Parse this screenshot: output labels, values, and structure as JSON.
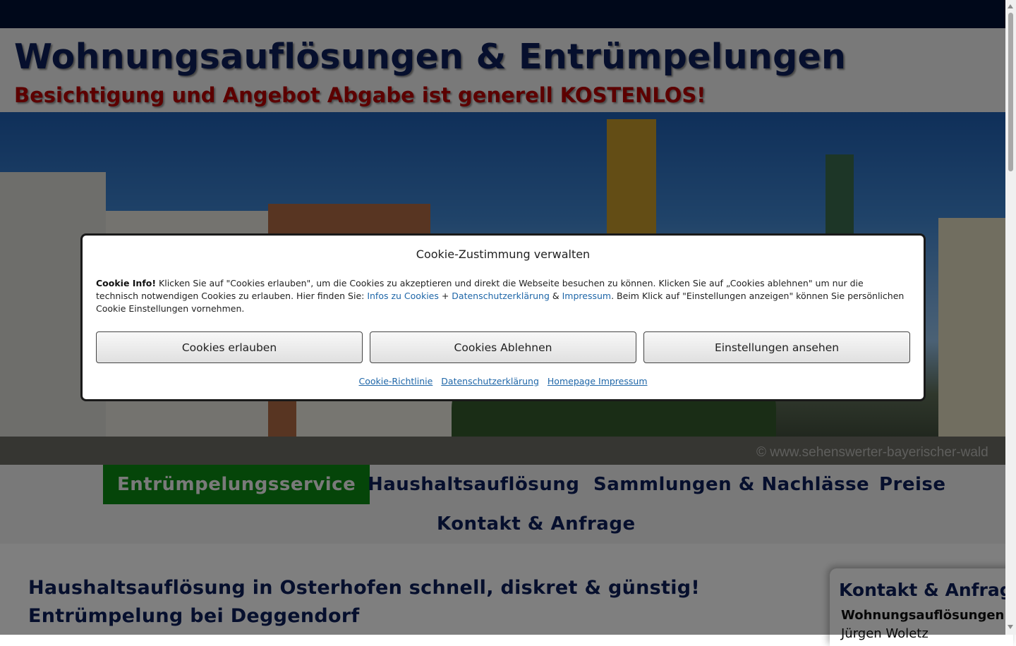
{
  "header": {
    "title": "Wohnungsauflösungen & Entrümpelungen",
    "subtitle": "Besichtigung und Angebot Abgabe ist generell KOSTENLOS!"
  },
  "hero": {
    "watermark": "© www.sehenswerter-bayerischer-wald"
  },
  "nav": {
    "items": [
      {
        "label": "Entrümpelungsservice",
        "active": true
      },
      {
        "label": "Haushaltsauflösung"
      },
      {
        "label": "Sammlungen & Nachlässe"
      },
      {
        "label": "Preise"
      },
      {
        "label": "Kontakt & Anfrage"
      }
    ]
  },
  "main": {
    "title": "Haushaltsauflösung in Osterhofen schnell, diskret & günstig! Entrümpe­lung bei Deggendorf"
  },
  "sidebar_widget": {
    "title": "Kontakt & Anfrag",
    "line1": "Wohnungsauflösungen",
    "line2": "Jürgen Woletz"
  },
  "cookie_dialog": {
    "title": "Cookie-Zustimmung verwalten",
    "info_label": "Cookie Info!",
    "text_part1": " Klicken Sie auf \"Cookies erlauben\", um die Cookies zu akzeptieren und direkt die Webseite besuchen zu können. Klicken Sie auf „Cookies ablehnen\" um nur die technisch notwendigen Cookies zu erlauben. Hier finden Sie: ",
    "link_infos": "Infos zu Cookies",
    "plus": " + ",
    "link_privacy": "Datenschutzerklärung",
    "amp": " & ",
    "link_imprint": "Impressum",
    "text_part2": ". Beim Klick auf \"Einstellungen anzeigen\" können Sie persönlichen Cookie Einstellungen vornehmen.",
    "buttons": {
      "accept": "Cookies erlauben",
      "deny": "Cookies Ablehnen",
      "settings": "Einstellungen ansehen"
    },
    "footer_links": {
      "cookie_policy": "Cookie-Richtlinie",
      "privacy": "Datenschutzerklärung",
      "imprint": "Homepage Impressum"
    }
  }
}
